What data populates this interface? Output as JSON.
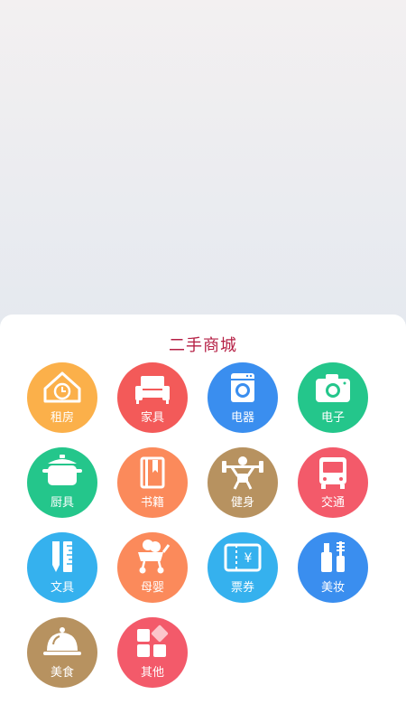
{
  "panel": {
    "title": "二手商城"
  },
  "categories": [
    {
      "label": "租房",
      "icon": "house-clock-icon",
      "color": "#fbb04a"
    },
    {
      "label": "家具",
      "icon": "sofa-icon",
      "color": "#f35a59"
    },
    {
      "label": "电器",
      "icon": "washing-machine-icon",
      "color": "#3a8eef"
    },
    {
      "label": "电子",
      "icon": "camera-icon",
      "color": "#24c68b"
    },
    {
      "label": "厨具",
      "icon": "cooking-pot-icon",
      "color": "#24c68b"
    },
    {
      "label": "书籍",
      "icon": "book-icon",
      "color": "#fb8a5b"
    },
    {
      "label": "健身",
      "icon": "weightlifter-icon",
      "color": "#b79260"
    },
    {
      "label": "交通",
      "icon": "bus-icon",
      "color": "#f35a6a"
    },
    {
      "label": "文具",
      "icon": "pencil-ruler-icon",
      "color": "#35b1ee"
    },
    {
      "label": "母婴",
      "icon": "baby-stroller-icon",
      "color": "#fb8a5b"
    },
    {
      "label": "票券",
      "icon": "ticket-icon",
      "color": "#35b1ee"
    },
    {
      "label": "美妆",
      "icon": "cosmetics-icon",
      "color": "#3a8eef"
    },
    {
      "label": "美食",
      "icon": "food-cloche-icon",
      "color": "#b79260"
    },
    {
      "label": "其他",
      "icon": "grid-blocks-icon",
      "color": "#f35a6a"
    }
  ]
}
